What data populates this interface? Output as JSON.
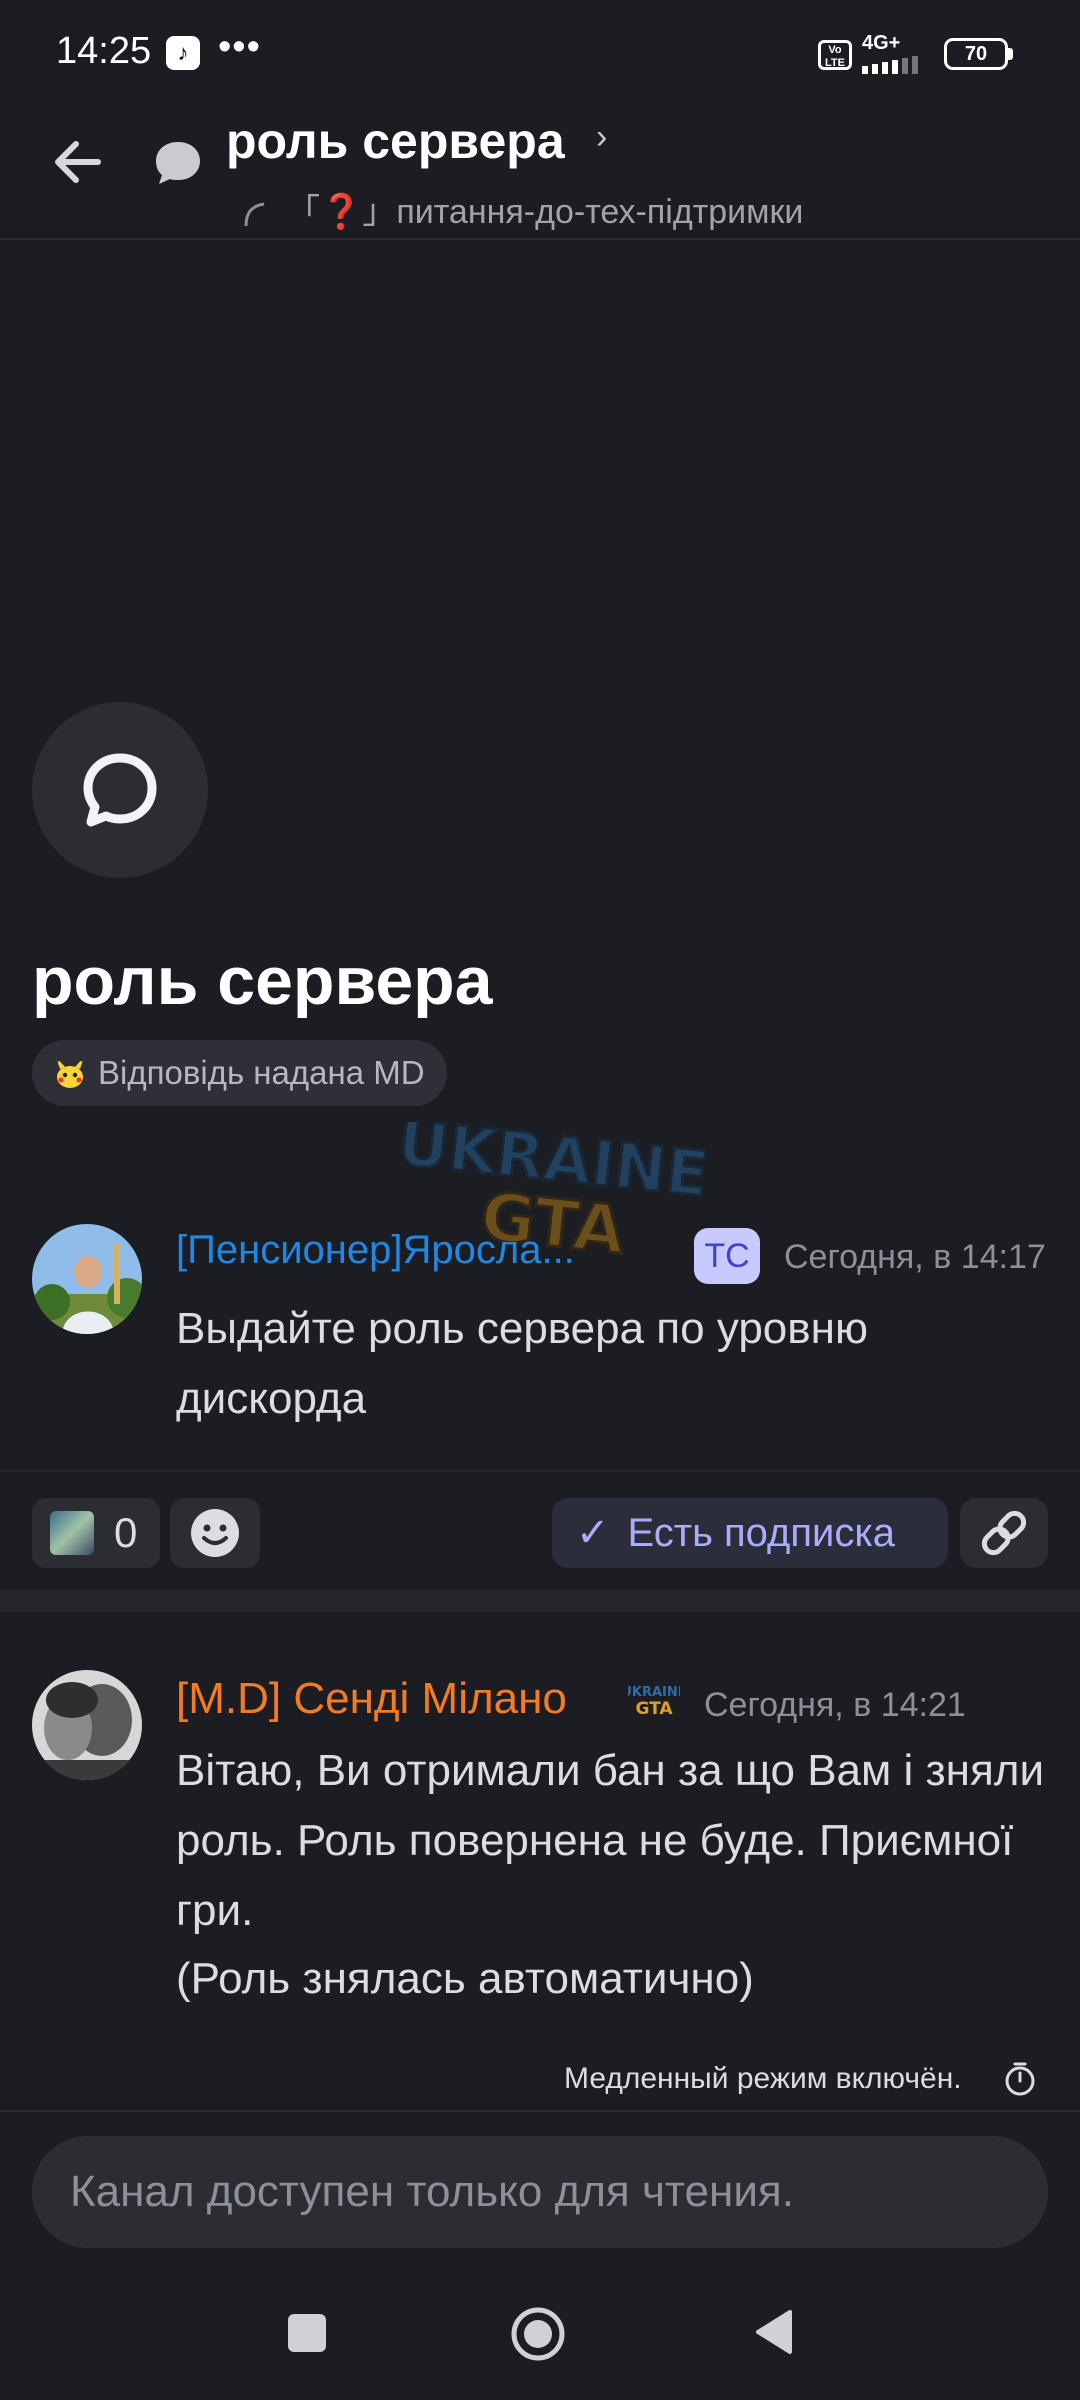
{
  "status_bar": {
    "time": "14:25",
    "dots": "•••",
    "volte": "Vo LTE",
    "network": "4G+",
    "battery": "70"
  },
  "header": {
    "title": "роль сервера",
    "chevron": "›",
    "parent_channel": "「❓」питання-до-тех-підтримки"
  },
  "thread": {
    "title": "роль сервера",
    "answer_tag": "Відповідь надана MD"
  },
  "messages": [
    {
      "author": "[Пенсионер]Яросла...",
      "badge": "ТС",
      "timestamp": "Сегодня, в 14:17",
      "text": "Выдайте роль сервера по уровню дискорда",
      "name_color": "#1e88e5"
    },
    {
      "author": "[M.D] Сенді Мілано",
      "timestamp": "Сегодня, в 14:21",
      "text": "Вітаю, Ви отримали бан за що Вам і зняли роль. Роль повернена не буде. Приємної гри.",
      "text2": "(Роль знялась автоматично)",
      "name_color": "#f47b20"
    }
  ],
  "actions": {
    "reaction_count": "0",
    "follow_label": "Есть подписка",
    "follow_check": "✓"
  },
  "slowmode": "Медленный режим включён.",
  "composer": {
    "placeholder": "Канал доступен только для чтения."
  }
}
